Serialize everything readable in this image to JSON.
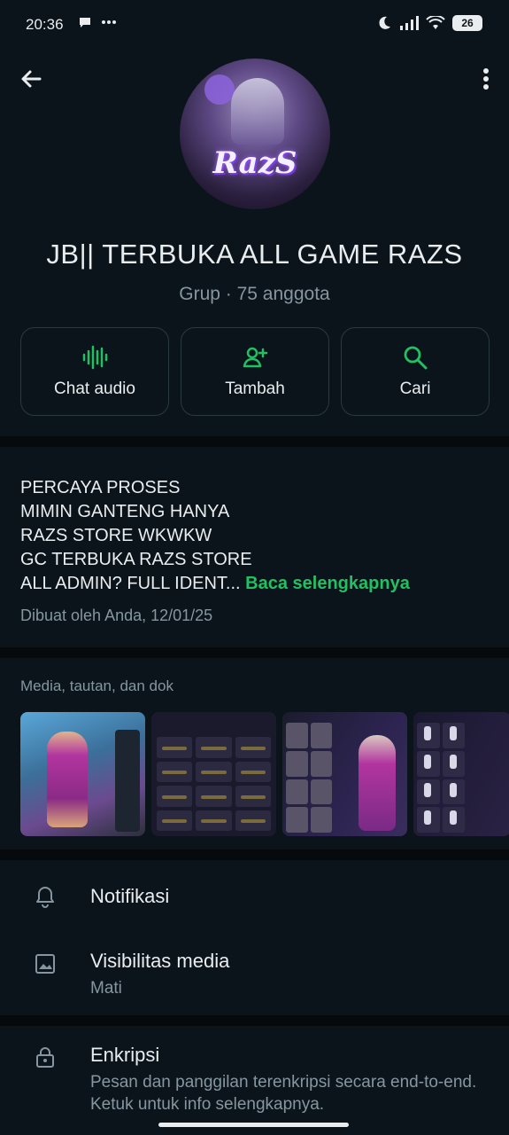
{
  "status_bar": {
    "time": "20:36",
    "battery": "26",
    "icons": [
      "chat-bubble-icon",
      "dots-icon",
      "moon-icon",
      "signal-icon",
      "wifi-icon",
      "battery-icon"
    ]
  },
  "header": {
    "back_icon": "arrow-left-icon",
    "menu_icon": "vertical-dots-icon"
  },
  "group": {
    "avatar_logo_text": "RazS",
    "title": "JB|| TERBUKA ALL GAME RAZS",
    "meta": "Grup · 75 anggota"
  },
  "actions": [
    {
      "label": "Chat audio",
      "icon": "audio-wave-icon"
    },
    {
      "label": "Tambah",
      "icon": "add-person-icon"
    },
    {
      "label": "Cari",
      "icon": "search-icon"
    }
  ],
  "description": {
    "lines": [
      "PERCAYA PROSES",
      "MIMIN GANTENG HANYA",
      "RAZS STORE WKWKW",
      "GC TERBUKA RAZS STORE",
      "ALL ADMIN? FULL IDENT..."
    ],
    "read_more": "Baca selengkapnya",
    "created": "Dibuat oleh Anda, 12/01/25"
  },
  "media": {
    "title": "Media, tautan, dan dok"
  },
  "settings": {
    "notifications": {
      "title": "Notifikasi",
      "icon": "bell-icon"
    },
    "media_visibility": {
      "title": "Visibilitas media",
      "value": "Mati",
      "icon": "image-icon"
    },
    "encryption": {
      "title": "Enkripsi",
      "description": "Pesan dan panggilan terenkripsi secara end-to-end. Ketuk untuk info selengkapnya.",
      "icon": "lock-icon"
    }
  },
  "colors": {
    "background": "#0b141a",
    "accent": "#21c063",
    "secondary_text": "#8696a0"
  }
}
